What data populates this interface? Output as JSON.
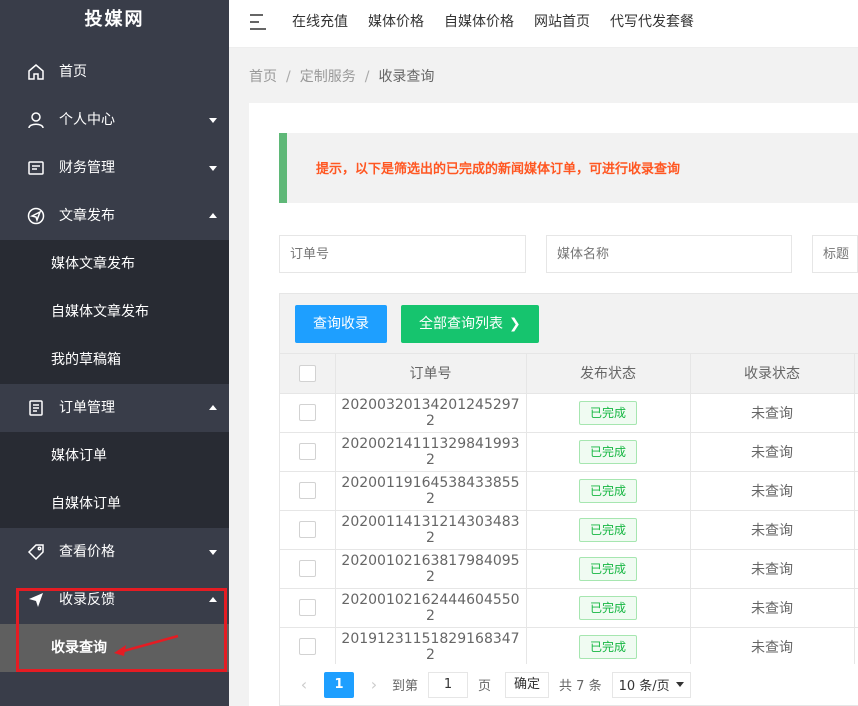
{
  "sidebar": {
    "logo": "投媒网",
    "items": [
      {
        "label": "首页"
      },
      {
        "label": "个人中心"
      },
      {
        "label": "财务管理"
      },
      {
        "label": "文章发布",
        "sub": [
          "媒体文章发布",
          "自媒体文章发布",
          "我的草稿箱"
        ]
      },
      {
        "label": "订单管理",
        "sub": [
          "媒体订单",
          "自媒体订单"
        ]
      },
      {
        "label": "查看价格"
      },
      {
        "label": "收录反馈",
        "sub": [
          "收录查询"
        ]
      }
    ]
  },
  "header": {
    "nav": [
      "在线充值",
      "媒体价格",
      "自媒体价格",
      "网站首页",
      "代写代发套餐"
    ]
  },
  "breadcrumb": [
    "首页",
    "定制服务",
    "收录查询"
  ],
  "tip": "提示，以下是筛选出的已完成的新闻媒体订单，可进行收录查询",
  "filters": {
    "order_no_placeholder": "订单号",
    "media_name_placeholder": "媒体名称",
    "title_placeholder": "标题"
  },
  "toolbar": {
    "query_label": "查询收录",
    "list_label": "全部查询列表"
  },
  "table": {
    "headers": [
      "订单号",
      "发布状态",
      "收录状态"
    ],
    "rows": [
      {
        "order": "20200320134201245297 2",
        "publish": "已完成",
        "index": "未查询"
      },
      {
        "order": "20200214111329841993 2",
        "publish": "已完成",
        "index": "未查询"
      },
      {
        "order": "20200119164538433855 2",
        "publish": "已完成",
        "index": "未查询"
      },
      {
        "order": "20200114131214303483 2",
        "publish": "已完成",
        "index": "未查询"
      },
      {
        "order": "20200102163817984095 2",
        "publish": "已完成",
        "index": "未查询"
      },
      {
        "order": "20200102162444604550 2",
        "publish": "已完成",
        "index": "未查询"
      },
      {
        "order": "20191231151829168347 2",
        "publish": "已完成",
        "index": "未查询"
      }
    ]
  },
  "pager": {
    "current": "1",
    "goto_label": "到第",
    "page_input": "1",
    "page_unit": "页",
    "confirm": "确定",
    "total": "共 7 条",
    "page_size": "10 条/页"
  },
  "colors": {
    "sidebar_bg": "#393d49",
    "submenu_bg": "#282b33",
    "accent_blue": "#1e9fff",
    "accent_green": "#16c46e",
    "tip_text": "#ff5722",
    "highlight": "#e51c23"
  }
}
